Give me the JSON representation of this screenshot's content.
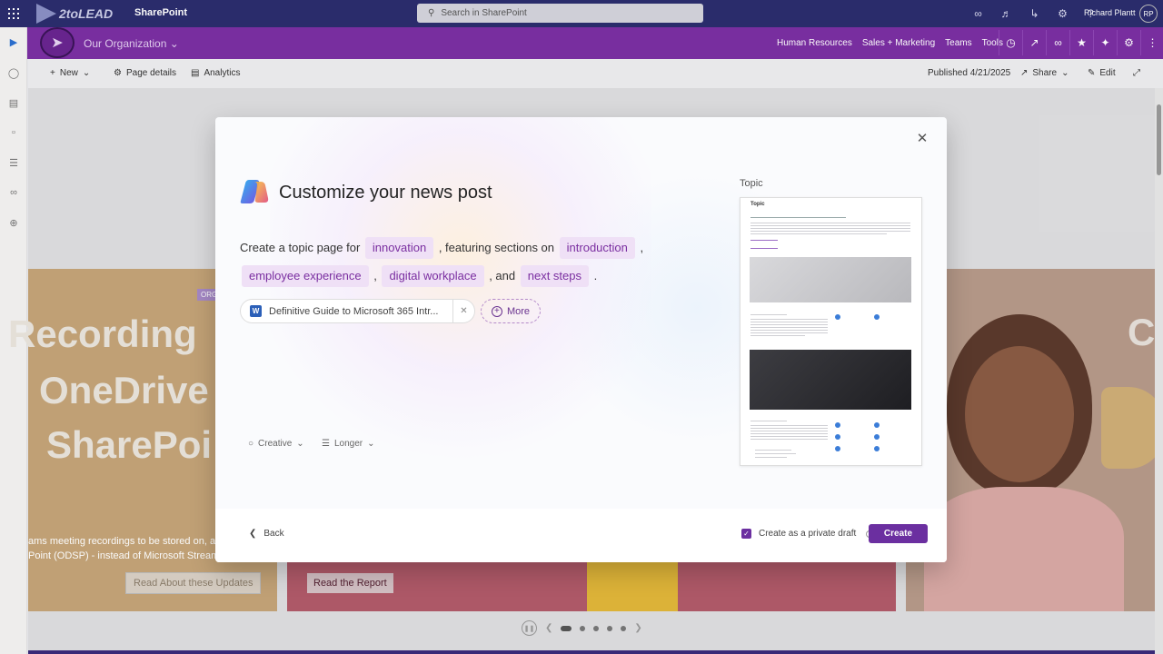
{
  "suitebar": {
    "brand": "2toLEAD",
    "app_name": "SharePoint",
    "search_placeholder": "Search in SharePoint",
    "user_name": "Richard Plantt",
    "user_initials": "RP"
  },
  "site": {
    "title": "Our Organization",
    "nav": [
      "Human Resources",
      "Sales + Marketing",
      "Teams",
      "Tools"
    ]
  },
  "command_bar": {
    "new": "New",
    "page_details": "Page details",
    "analytics": "Analytics",
    "published": "Published 4/21/2025",
    "share": "Share",
    "edit": "Edit"
  },
  "background": {
    "hero1_lines": [
      "Recording",
      "OneDrive",
      "SharePoi"
    ],
    "hero1_badge": "ORG",
    "hero1_small1": "ams meeting recordings to be stored on, a",
    "hero1_small2": "Point (ODSP) - instead of Microsoft Stream",
    "hero1_button": "Read About these Updates",
    "hero2_button": "Read the Report",
    "hero3_letter": "C"
  },
  "modal": {
    "title": "Customize your news post",
    "prompt": {
      "p1": "Create a",
      "type": "topic",
      "p2": "page for",
      "topic": "innovation",
      "p3": ", featuring sections on",
      "s1": "introduction",
      "p4": ",",
      "s2": "employee experience",
      "p5": ",",
      "s3": "digital workplace",
      "p6": ", and",
      "s4": "next steps",
      "p7": "."
    },
    "file_chip": "Definitive Guide to Microsoft 365 Intr...",
    "more_label": "More",
    "tone": "Creative",
    "length": "Longer",
    "preview_label": "Topic",
    "preview_title": "Topic",
    "back": "Back",
    "private_draft": "Create as a private draft",
    "create": "Create"
  },
  "colors": {
    "suitebar": "#2b2d6e",
    "sitebar": "#7b2fa3",
    "accent": "#6b2fa0",
    "chip_bg": "#efe0f6"
  }
}
